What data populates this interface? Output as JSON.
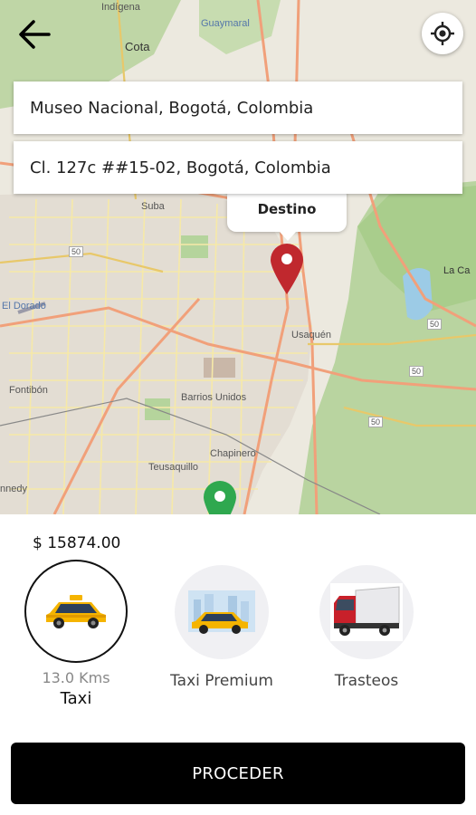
{
  "map": {
    "labels": {
      "indigena": "Indígena",
      "cota": "Cota",
      "guaymaral": "Guaymaral",
      "suba": "Suba",
      "usaquen": "Usaquén",
      "el_dorado": "El Dorado",
      "fontibon": "Fontibón",
      "barrios_unidos": "Barrios Unidos",
      "chapinero": "Chapinero",
      "teusaquillo": "Teusaquillo",
      "kennedy": "nnedy",
      "la_calera": "La Ca",
      "road_50a": "50",
      "road_50b": "50",
      "road_50c": "50",
      "road_50d": "50",
      "road_50e": "50"
    },
    "destination_label": "Destino",
    "pin_colors": {
      "destination": "#c0282e",
      "origin": "#2fa84f"
    }
  },
  "nav": {
    "back_icon": "arrow-left-icon",
    "locate_icon": "crosshair-icon"
  },
  "origin_address": "Museo Nacional, Bogotá, Colombia",
  "destination_address": "Cl. 127c ##15-02, Bogotá, Colombia",
  "fare": "$ 15874.00",
  "options": [
    {
      "name": "Taxi",
      "distance": "13.0 Kms",
      "selected": true
    },
    {
      "name": "Taxi Premium",
      "selected": false
    },
    {
      "name": "Trasteos",
      "selected": false
    }
  ],
  "proceed_label": "PROCEDER"
}
